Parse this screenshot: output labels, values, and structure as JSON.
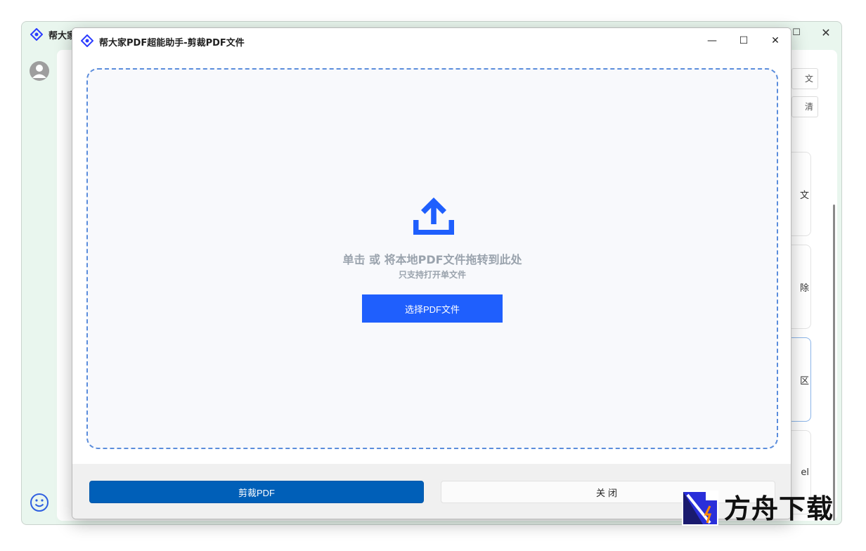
{
  "background_window": {
    "title_partial": "帮大家",
    "maximize_glyph": "☐",
    "close_glyph": "✕",
    "right_buttons": [
      "文",
      "清"
    ],
    "right_cards": [
      "文",
      "除",
      "区",
      "el"
    ]
  },
  "dialog": {
    "title": "帮大家PDF超能助手-剪裁PDF文件",
    "controls": {
      "minimize": "—",
      "maximize": "☐",
      "close": "✕"
    },
    "dropzone": {
      "main_text": "单击 或 将本地PDF文件拖转到此处",
      "sub_text": "只支持打开单文件",
      "select_button": "选择PDF文件"
    },
    "footer": {
      "crop_button": "剪裁PDF",
      "close_button": "关闭"
    }
  },
  "watermark": {
    "text": "方舟下载"
  },
  "colors": {
    "accent_blue": "#1f5ffd",
    "primary_button": "#005fb8",
    "dash_border": "#5b8ddc",
    "app_background": "#e9f6ee"
  }
}
